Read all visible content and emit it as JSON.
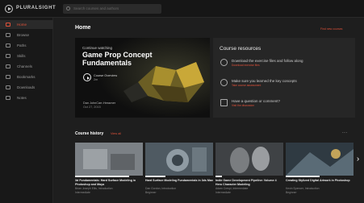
{
  "topbar": {
    "brand": "PLURALSIGHT",
    "search_placeholder": "Search courses and authors"
  },
  "sidebar": {
    "items": [
      {
        "label": "Home",
        "active": true
      },
      {
        "label": "Browse"
      },
      {
        "label": "Paths"
      },
      {
        "label": "Skills"
      },
      {
        "label": "Channels"
      },
      {
        "label": "Bookmarks"
      },
      {
        "label": "Downloads"
      },
      {
        "label": "Notes"
      }
    ]
  },
  "main": {
    "title": "Home",
    "top_link": "Find new courses",
    "hero": {
      "subtitle": "Continue watching",
      "title": "Game Prop Concept Fundamentals",
      "overview": "Course Overview",
      "length": "2m",
      "author": "Dan JohnCarr-Hessmer",
      "date": "Oct 27, 2015"
    },
    "resources": {
      "title": "Course resources",
      "items": [
        {
          "text": "Download the exercise files and follow along",
          "link": "Download exercise files",
          "icon": "download-icon"
        },
        {
          "text": "Make sure you learned the key concepts",
          "link": "Take course assessment",
          "icon": "check-circle-icon"
        },
        {
          "text": "Have a question or comment?",
          "link": "Visit the discussion",
          "icon": "comment-icon"
        }
      ]
    },
    "history": {
      "title": "Course history",
      "link": "View all",
      "more": "...",
      "cards": [
        {
          "title": "3d Fundamentals: Hard Surface Modeling in Photoshop and Maya",
          "author": "Brian Joseph Ellis, Introduction",
          "level": "Intermediate",
          "progress": 0.8,
          "color": "#8a8f94"
        },
        {
          "title": "Hard Surface Modeling Fundamentals in 3ds Max",
          "author": "Dan Gordon, Introduction",
          "level": "Beginner",
          "progress": 0.3,
          "color": "#5e6a72"
        },
        {
          "title": "Indie Game Development Pipeline: Volume 4 Hero Character Modeling",
          "author": "Adam Crespi, Intermediate",
          "level": "Intermediate",
          "progress": 0.1,
          "color": "#46494c"
        },
        {
          "title": "Creating Stylized Digital Artwork in Photoshop",
          "author": "Kevin Spencer, Introduction",
          "level": "Beginner",
          "progress": 0.5,
          "color": "#3d4a52"
        }
      ]
    }
  }
}
